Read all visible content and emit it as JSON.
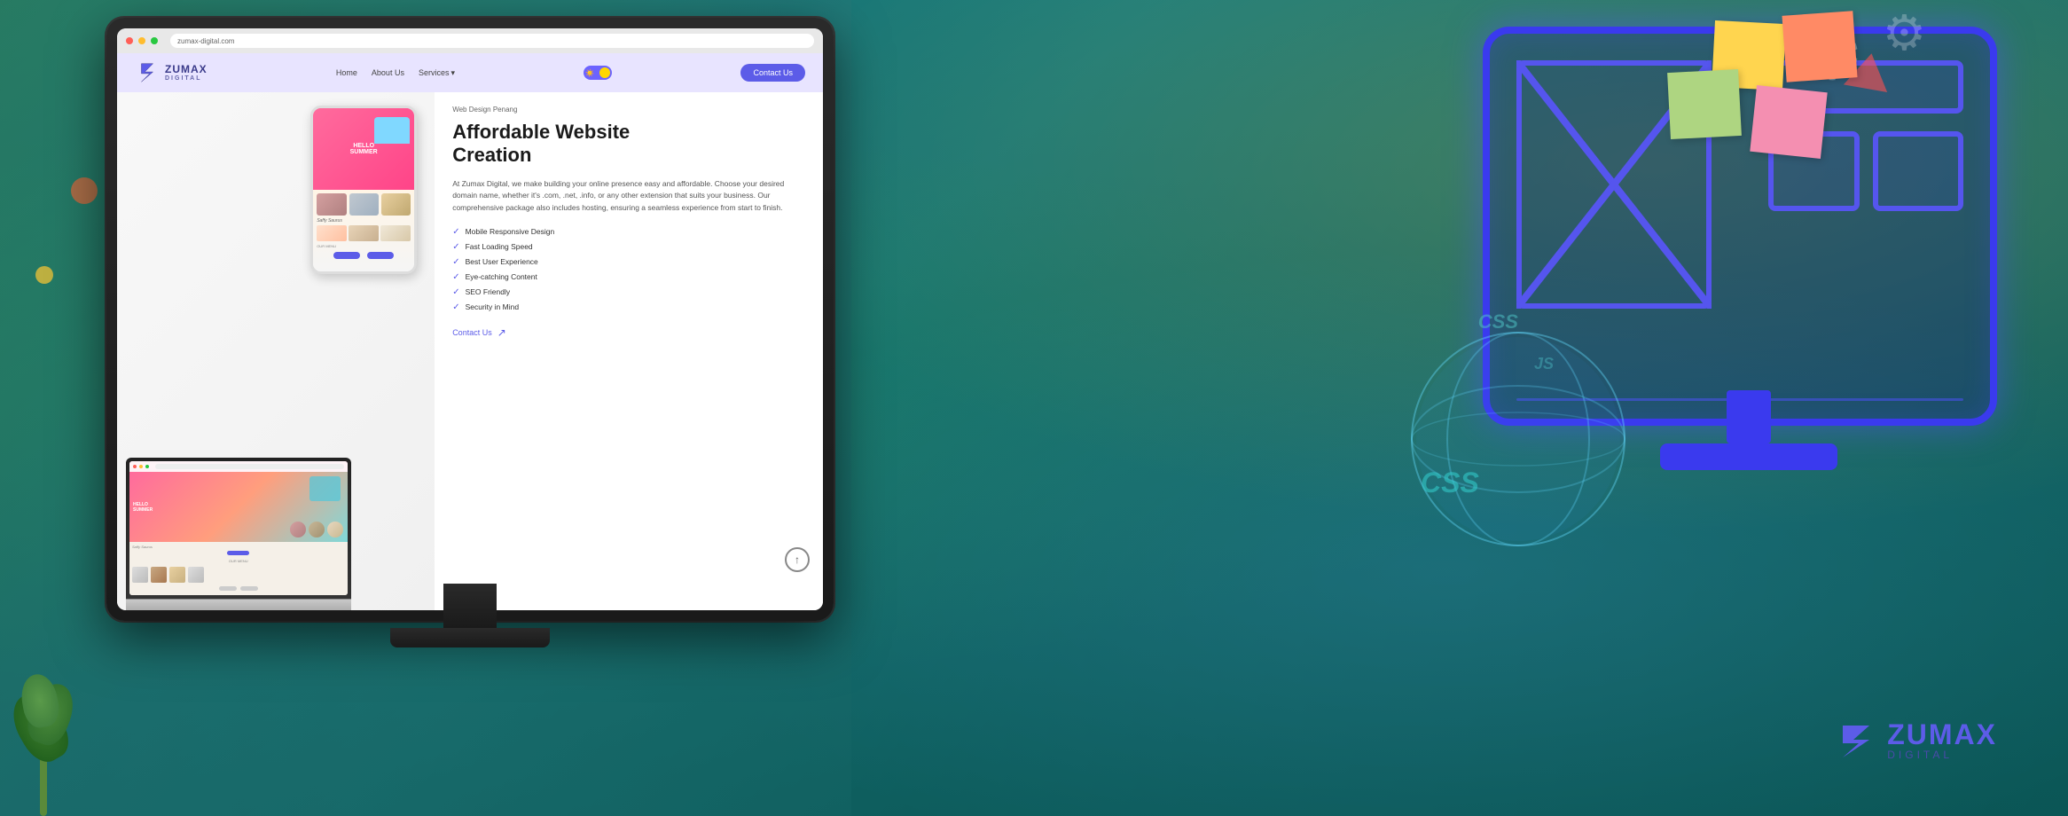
{
  "background": {
    "color_left": "#2a8060",
    "color_right": "#1a7080"
  },
  "monitor_website": {
    "browser_url": "zumax-digital.com",
    "header": {
      "logo_name": "ZUMAX",
      "logo_sub": "DIGITAL",
      "nav_items": [
        "Home",
        "About Us",
        "Services ▾"
      ],
      "toggle_state": "dark",
      "contact_button": "Contact Us"
    },
    "hero": {
      "label": "Web Design Penang",
      "heading_line1": "Affordable Website",
      "heading_line2": "Creation",
      "description": "At Zumax Digital, we make building your online presence easy and affordable. Choose your desired domain name, whether it's .com, .net, .info, or any other extension that suits your business. Our comprehensive package also includes hosting, ensuring a seamless experience from start to finish.",
      "features": [
        "Mobile Responsive Design",
        "Fast Loading Speed",
        "Best User Experience",
        "Eye-catching Content",
        "SEO Friendly",
        "Security in Mind"
      ],
      "contact_link": "Contact Us"
    }
  },
  "illustration": {
    "monitor_border_color": "#3a3aee",
    "globe_color": "rgba(100,200,255,0.4)"
  },
  "zumax_logo_br": {
    "name": "ZUMAX",
    "sub": "DIGITAL"
  },
  "sticky_notes": [
    {
      "color": "#ffd54f",
      "text": ""
    },
    {
      "color": "#ff8a65",
      "text": ""
    },
    {
      "color": "#f48fb1",
      "text": ""
    },
    {
      "color": "#aed581",
      "text": ""
    }
  ],
  "css_labels": [
    "CSS",
    "JS"
  ]
}
